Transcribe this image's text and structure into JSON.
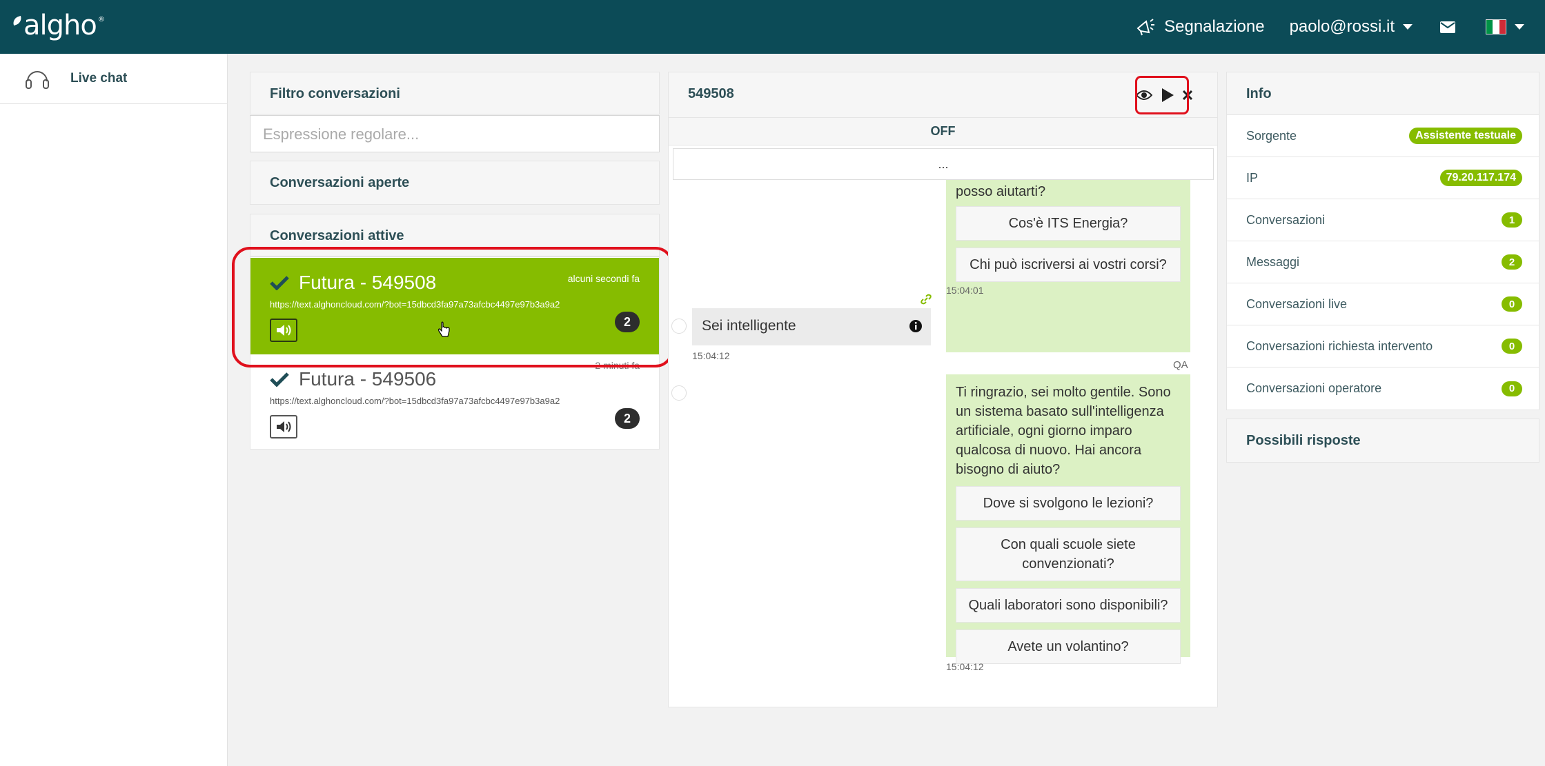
{
  "header": {
    "logo": "algho",
    "report_label": "Segnalazione",
    "user": "paolo@rossi.it"
  },
  "sidebar": {
    "items": [
      {
        "label": "Live chat",
        "icon": "headset-icon"
      }
    ]
  },
  "filter": {
    "title": "Filtro conversazioni",
    "placeholder": "Espressione regolare...",
    "open_section": "Conversazioni aperte",
    "active_section": "Conversazioni attive"
  },
  "conversations": [
    {
      "name": "Futura  - 549508",
      "url": "https://text.alghoncloud.com/?bot=15dbcd3fa97a73afcbc4497e97b3a9a2",
      "time": "alcuni secondi fa",
      "count": "2"
    },
    {
      "name": "Futura  - 549506",
      "url": "https://text.alghoncloud.com/?bot=15dbcd3fa97a73afcbc4497e97b3a9a2",
      "time": "2 minuti fa",
      "count": "2"
    }
  ],
  "chat": {
    "id": "549508",
    "status": "OFF",
    "more": "...",
    "bot1_text": "posso aiutarti?",
    "bot1_replies": [
      "Cos'è ITS Energia?",
      "Chi può iscriversi ai vostri corsi?"
    ],
    "bot1_time": "15:04:01",
    "user_msg": "Sei intelligente",
    "user_time": "15:04:12",
    "qa_label": "QA",
    "bot2_text": "Ti ringrazio, sei molto gentile. Sono un sistema basato sull'intelligenza artificiale, ogni giorno imparo qualcosa di nuovo. Hai ancora bisogno di aiuto?",
    "bot2_replies": [
      "Dove si svolgono le lezioni?",
      "Con quali scuole siete convenzionati?",
      "Quali laboratori sono disponibili?",
      "Avete un volantino?"
    ],
    "bot2_time": "15:04:12"
  },
  "info": {
    "title": "Info",
    "rows": [
      {
        "label": "Sorgente",
        "value": "Assistente testuale"
      },
      {
        "label": "IP",
        "value": "79.20.117.174"
      },
      {
        "label": "Conversazioni",
        "value": "1"
      },
      {
        "label": "Messaggi",
        "value": "2"
      },
      {
        "label": "Conversazioni live",
        "value": "0"
      },
      {
        "label": "Conversazioni richiesta intervento",
        "value": "0"
      },
      {
        "label": "Conversazioni operatore",
        "value": "0"
      }
    ],
    "answers_title": "Possibili risposte"
  },
  "colors": {
    "header": "#0c4b57",
    "accent": "#86bc00",
    "highlight": "#e0101c"
  }
}
